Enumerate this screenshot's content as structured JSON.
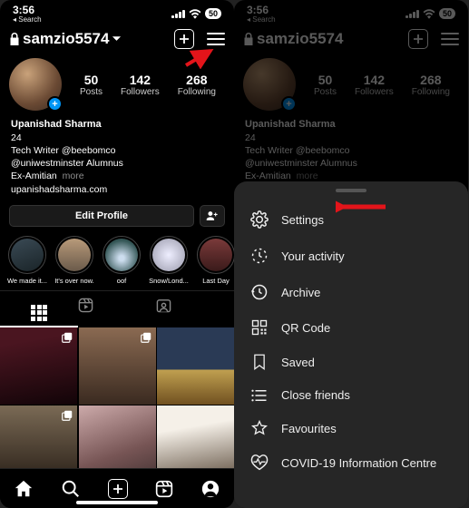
{
  "status": {
    "time": "3:56",
    "back": "Search",
    "battery": "50"
  },
  "header": {
    "lock": "🔒",
    "username": "samzio5574"
  },
  "stats": {
    "posts": {
      "num": "50",
      "label": "Posts"
    },
    "followers": {
      "num": "142",
      "label": "Followers"
    },
    "following": {
      "num": "268",
      "label": "Following"
    }
  },
  "bio": {
    "name": "Upanishad Sharma",
    "age": "24",
    "line1": "Tech Writer @beebomco",
    "line2": "@uniwestminster Alumnus",
    "line3_a": "Ex-Amitian",
    "more": "more",
    "link": "upanishadsharma.com"
  },
  "edit": {
    "label": "Edit Profile"
  },
  "highlights": [
    {
      "caption": "We made it...",
      "bg": "linear-gradient(160deg,#3a4a55,#1a2428)"
    },
    {
      "caption": "It's over now.",
      "bg": "linear-gradient(#b89a7a,#6a5a4a)"
    },
    {
      "caption": "oof",
      "bg": "radial-gradient(circle at 50% 60%,#cde 10%,#355 70%)"
    },
    {
      "caption": "Snow/Lond...",
      "bg": "radial-gradient(circle,#eef,#99a)"
    },
    {
      "caption": "Last Day",
      "bg": "linear-gradient(#7a3a3a,#3a1a1a)"
    }
  ],
  "posts": [
    {
      "bg": "linear-gradient(170deg,#4a1520 20%,#120408)",
      "multi": true
    },
    {
      "bg": "linear-gradient(180deg,#8a6a52,#3a2a20)",
      "multi": true
    },
    {
      "bg": "linear-gradient(180deg,#2a3a55 55%,#c0a050 55%,#705020)",
      "multi": false
    },
    {
      "bg": "linear-gradient(180deg,#7a6a55,#2a2018)",
      "multi": true
    },
    {
      "bg": "linear-gradient(160deg,#caa,#755 60%,#433)",
      "multi": false
    },
    {
      "bg": "linear-gradient(170deg,#f5f0e8 30%,#5a4a3a)",
      "multi": false
    }
  ],
  "menu": {
    "settings": "Settings",
    "activity": "Your activity",
    "archive": "Archive",
    "qr": "QR Code",
    "saved": "Saved",
    "close_friends": "Close friends",
    "favourites": "Favourites",
    "covid": "COVID-19 Information Centre"
  }
}
